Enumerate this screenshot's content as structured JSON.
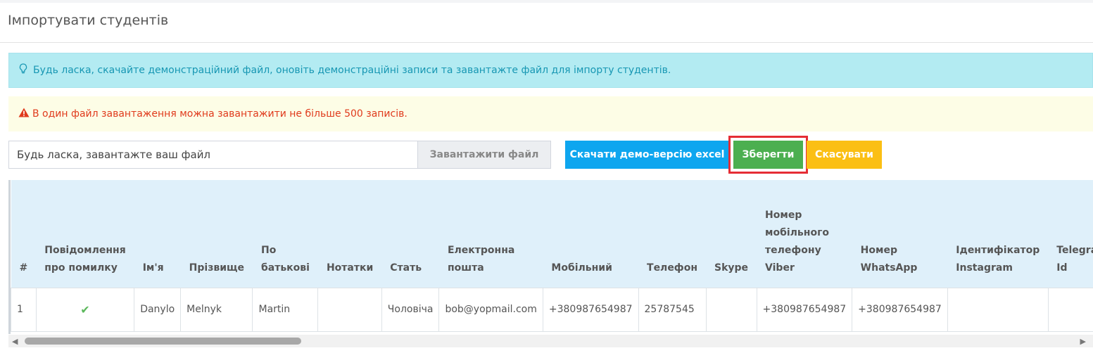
{
  "page": {
    "title": "Імпортувати студентів"
  },
  "alerts": {
    "info": "Будь ласка, скачайте демонстраційний файл, оновіть демонстраційні записи та завантажте файл для імпорту студентів.",
    "warning": "В один файл завантаження можна завантажити не більше 500 записів."
  },
  "upload": {
    "placeholder": "Будь ласка, завантажте ваш файл",
    "button_label": "Завантажити файл"
  },
  "actions": {
    "download_demo": "Скачати демо-версію excel",
    "save": "Зберегти",
    "cancel": "Скасувати"
  },
  "colors": {
    "info_bg": "#b3ebf2",
    "warning_text": "#e03a1c",
    "demo_button": "#0ea6ef",
    "save_button": "#4caf50",
    "cancel_button": "#fbbf14",
    "highlight_border": "#e52d35"
  },
  "table": {
    "columns": [
      "#",
      "Повідомлення про помилку",
      "Ім'я",
      "Прізвище",
      "По батькові",
      "Нотатки",
      "Стать",
      "Електронна пошта",
      "Мобільний",
      "Телефон",
      "Skype",
      "Номер мобільного телефону Viber",
      "Номер WhatsApp",
      "Ідентифікатор Instagram",
      "Telegram Id"
    ],
    "rows": [
      [
        "1",
        "",
        "Danylo",
        "Melnyk",
        "Martin",
        "",
        "Чоловіча",
        "bob@yopmail.com",
        "+380987654987",
        "25787545",
        "",
        "+380987654987",
        "+380987654987",
        "",
        ""
      ]
    ]
  }
}
